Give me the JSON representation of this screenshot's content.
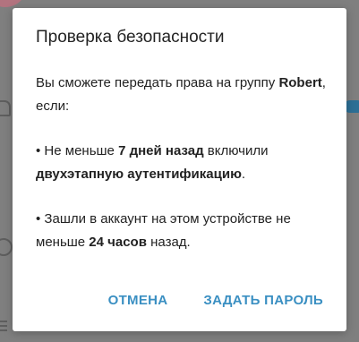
{
  "dialog": {
    "title": "Проверка безопасности",
    "intro": {
      "before": "Вы сможете передать права на группу ",
      "group": "Robert",
      "after": ", если:"
    },
    "condition1": {
      "before": "• Не меньше ",
      "days": "7 дней назад",
      "middle": " включили ",
      "feature": "двухэтапную аутентификацию",
      "after": "."
    },
    "condition2": {
      "before": "• Зашли в аккаунт на этом устройстве не меньше ",
      "hours": "24 часов",
      "after": " назад."
    },
    "buttons": {
      "cancel": "ОТМЕНА",
      "set_password": "ЗАДАТЬ ПАРОЛЬ"
    }
  },
  "colors": {
    "accent": "#3a8fc2",
    "overlay": "#7f7f7f"
  },
  "background_icons": [
    "avatar",
    "bell-icon",
    "toggle-switch",
    "person-icon",
    "menu-icon"
  ]
}
